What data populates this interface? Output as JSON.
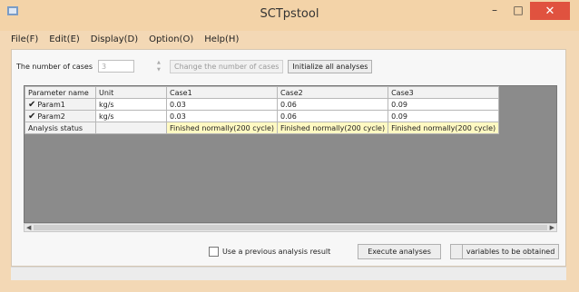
{
  "window": {
    "title": "SCTpstool",
    "minimize_glyph": "–",
    "maximize_glyph": "□",
    "close_glyph": "✕"
  },
  "menu": {
    "items": [
      {
        "label": "File(F)"
      },
      {
        "label": "Edit(E)"
      },
      {
        "label": "Display(D)"
      },
      {
        "label": "Option(O)"
      },
      {
        "label": "Help(H)"
      }
    ]
  },
  "controls": {
    "cases_label": "The number of cases",
    "cases_value": "3",
    "change_cases_label": "Change the number of cases",
    "initialize_label": "Initialize all analyses"
  },
  "grid": {
    "headers": [
      "Parameter name",
      "Unit",
      "Case1",
      "Case2",
      "Case3"
    ],
    "rows": [
      {
        "name": "Param1",
        "checked": true,
        "unit": "kg/s",
        "values": [
          "0.03",
          "0.06",
          "0.09"
        ]
      },
      {
        "name": "Param2",
        "checked": true,
        "unit": "kg/s",
        "values": [
          "0.03",
          "0.06",
          "0.09"
        ]
      }
    ],
    "status_row": {
      "label": "Analysis status",
      "values": [
        "Finished normally(200 cycle)",
        "Finished normally(200 cycle)",
        "Finished normally(200 cycle)"
      ]
    },
    "check_glyph": "✔"
  },
  "bottom": {
    "use_previous_label": "Use a previous analysis result",
    "use_previous_checked": false,
    "execute_label": "Execute analyses",
    "variables_label": "variables to be obtained"
  },
  "colors": {
    "window_frame": "#f3d8b5",
    "close_button": "#e0523f",
    "grid_background": "#8b8b8b",
    "status_cell": "#fff9c2"
  },
  "icons": {
    "app": "app-icon",
    "spin_up": "▲",
    "spin_down": "▼",
    "scroll_left": "◀",
    "scroll_right": "▶"
  }
}
